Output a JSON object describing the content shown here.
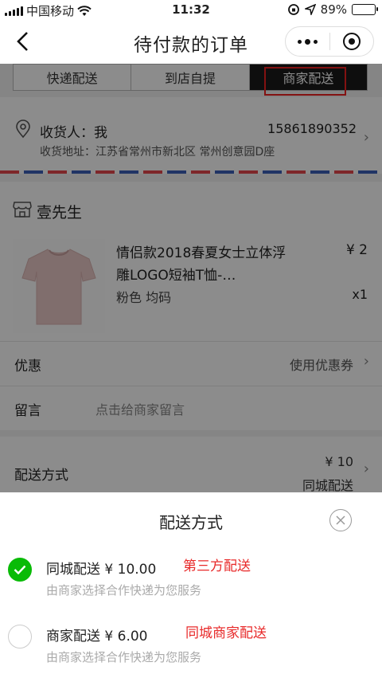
{
  "status_bar": {
    "carrier": "中国移动",
    "time": "11:32",
    "battery": "89%",
    "battery_level": 0.89
  },
  "nav": {
    "title": "待付款的订单"
  },
  "delivery_tabs": [
    {
      "label": "快递配送",
      "active": false
    },
    {
      "label": "到店自提",
      "active": false
    },
    {
      "label": "商家配送",
      "active": true
    }
  ],
  "address": {
    "recipient": "收货人：我",
    "phone": "15861890352",
    "line": "收货地址：江苏省常州市新北区 常州创意园D座"
  },
  "store": {
    "name": "壹先生"
  },
  "product": {
    "title": "情侣款2018春夏女士立体浮雕LOGO短袖T恤-…",
    "spec": "粉色 均码",
    "price": "¥ 2",
    "quantity": "x1"
  },
  "coupon_row": {
    "label": "优惠",
    "value": "使用优惠券"
  },
  "message_row": {
    "label": "留言",
    "placeholder": "点击给商家留言"
  },
  "delivery_row": {
    "label": "配送方式",
    "price": "¥ 10",
    "method": "同城配送"
  },
  "sheet": {
    "title": "配送方式",
    "options": [
      {
        "name": "同城配送 ¥ 10.00",
        "desc": "由商家选择合作快递为您服务",
        "checked": true,
        "note": "第三方配送"
      },
      {
        "name": "商家配送 ¥ 6.00",
        "desc": "由商家选择合作快递为您服务",
        "checked": false,
        "note": "同城商家配送"
      }
    ]
  },
  "colors": {
    "accent_green": "#09bb07",
    "annotation_red": "#e82a2a"
  }
}
